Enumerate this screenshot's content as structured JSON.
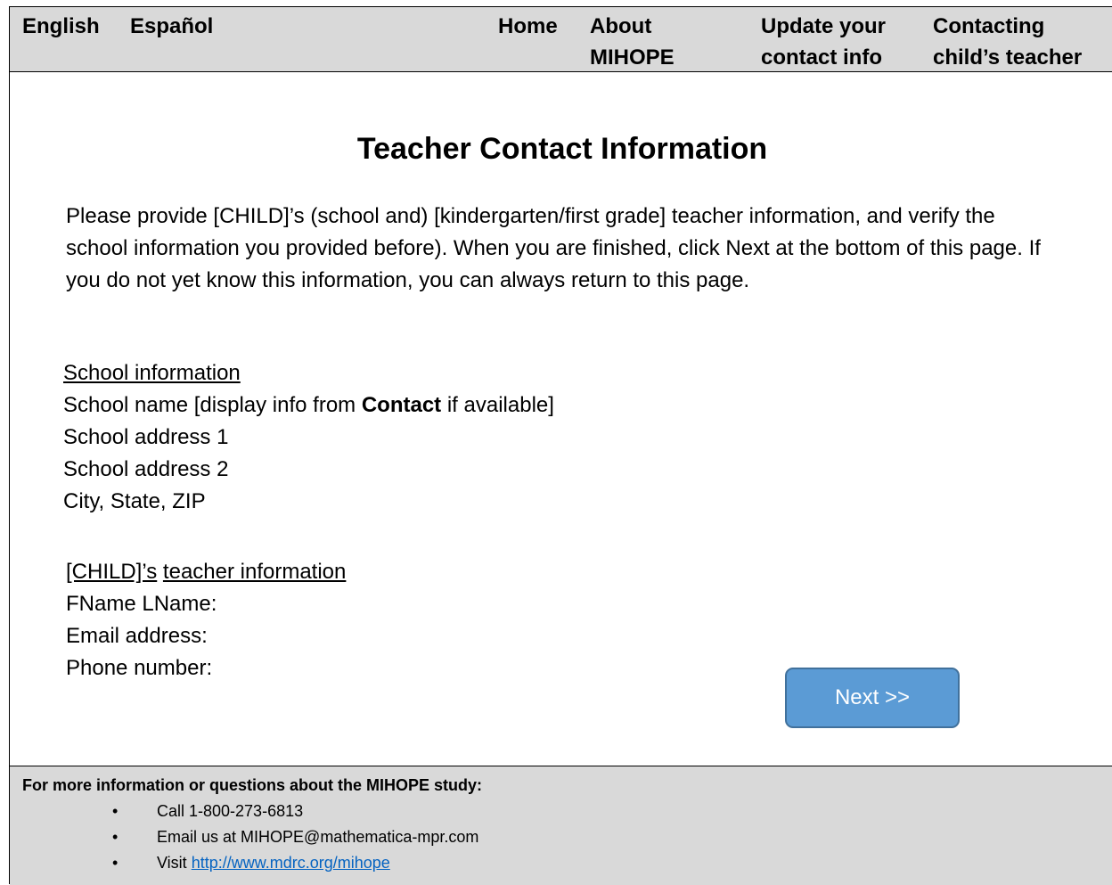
{
  "nav": {
    "english": "English",
    "espanol": "Español",
    "home": "Home",
    "about_line1": "About",
    "about_line2": "MIHOPE",
    "update_line1": "Update your",
    "update_line2": "contact info",
    "contacting_line1": "Contacting",
    "contacting_line2": "child’s teacher"
  },
  "page": {
    "title": "Teacher Contact Information",
    "intro": "Please provide [CHILD]’s (school and) [kindergarten/first grade] teacher information, and verify the school information you provided before). When you are finished, click Next at the bottom of this page. If you do not yet know this information, you can always return to this page."
  },
  "school": {
    "heading": "School information",
    "name_prefix": "School name [display info from ",
    "name_bold": "Contact",
    "name_suffix": " if available]",
    "address1": "School address 1",
    "address2": "School address 2",
    "city_state_zip": "City, State, ZIP"
  },
  "teacher": {
    "heading_part1": "[CHILD]’s",
    "heading_part2": "teacher information",
    "name": "FName LName:",
    "email": "Email address:",
    "phone": "Phone number:"
  },
  "next_button": "Next >>",
  "footer": {
    "title": "For more information or questions about the MIHOPE study:",
    "bullet": "•",
    "call": "Call 1-800-273-6813",
    "email": "Email us at MIHOPE@mathematica-mpr.com",
    "visit_prefix": "Visit ",
    "visit_link": "http://www.mdrc.org/mihope"
  },
  "colors": {
    "bar_background": "#d9d9d9",
    "button_fill": "#5b9bd5",
    "button_border": "#41719c",
    "link": "#0563c1"
  }
}
